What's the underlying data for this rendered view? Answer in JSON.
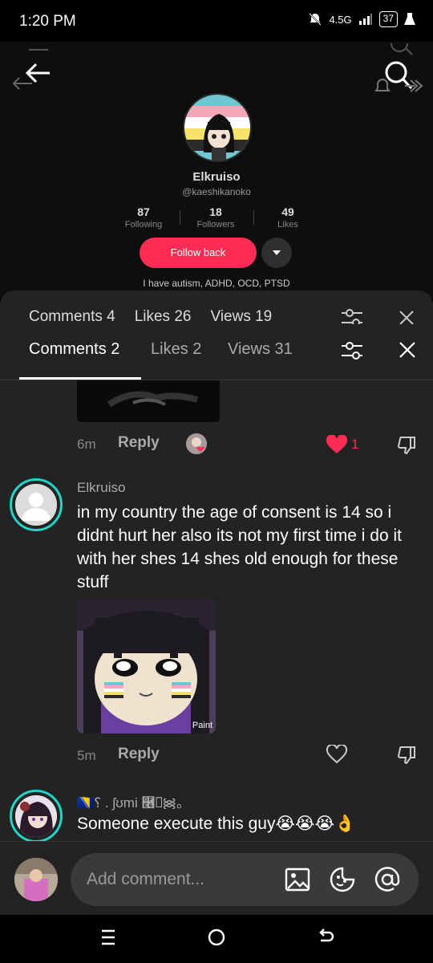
{
  "status": {
    "time": "1:20 PM",
    "network": "4.5G",
    "battery": "37"
  },
  "profile": {
    "name": "Elkruiso",
    "handle": "@kaeshikanoko",
    "following_count": "87",
    "following_label": "Following",
    "followers_count": "18",
    "followers_label": "Followers",
    "likes_count": "49",
    "likes_label": "Likes",
    "follow_label": "Follow back",
    "bio": "I have autism, ADHD, OCD, PTSD"
  },
  "ghost_tabs": {
    "comments": "Comments 4",
    "likes": "Likes 26",
    "views": "Views 19"
  },
  "tabs": {
    "comments": "Comments 2",
    "likes": "Likes 2",
    "views": "Views 31"
  },
  "comments": [
    {
      "time": "6m",
      "reply_label": "Reply",
      "like_count": "1"
    },
    {
      "name": "Elkruiso",
      "text": "in my country the age of consent is 14 so i didnt hurt her also its not my first time i do it with her shes 14 shes old enough for these stuff",
      "image_watermark": "Paint",
      "time": "5m",
      "reply_label": "Reply"
    },
    {
      "name": "🇧🇦⸮   .   ʃʊmi  ࿦⎕᯼｡",
      "text": "Someone execute this guy😭😭😭👌"
    }
  ],
  "input": {
    "placeholder": "Add comment..."
  },
  "colors": {
    "accent": "#fe2c55",
    "ring": "#22d3c6",
    "sheet": "#232323"
  }
}
